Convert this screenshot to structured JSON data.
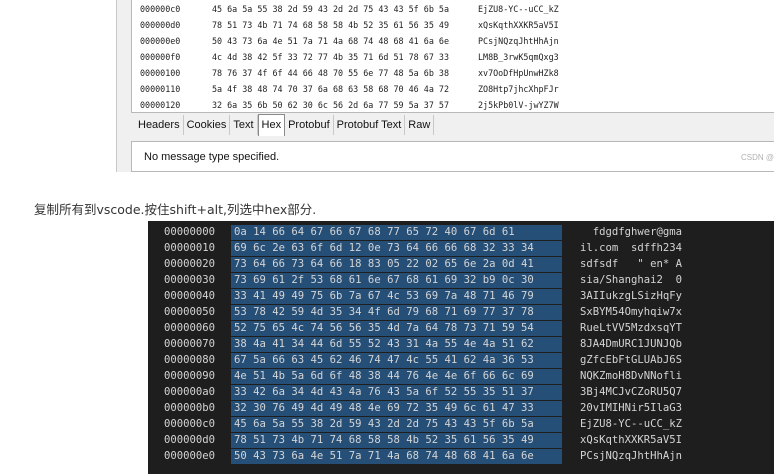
{
  "top_panel": {
    "rows": [
      {
        "offset": "000000c0",
        "hex": "45 6a 5a 55 38 2d 59 43 2d 2d 75 43 43 5f 6b 5a",
        "ascii": "EjZU8-YC--uCC_kZ"
      },
      {
        "offset": "000000d0",
        "hex": "78 51 73 4b 71 74 68 58 58 4b 52 35 61 56 35 49",
        "ascii": "xQsKqthXXKR5aV5I"
      },
      {
        "offset": "000000e0",
        "hex": "50 43 73 6a 4e 51 7a 71 4a 68 74 48 68 41 6a 6e",
        "ascii": "PCsjNQzqJhtHhAjn"
      },
      {
        "offset": "000000f0",
        "hex": "4c 4d 38 42 5f 33 72 77 4b 35 71 6d 51 78 67 33",
        "ascii": "LM8B_3rwK5qmQxg3"
      },
      {
        "offset": "00000100",
        "hex": "78 76 37 4f 6f 44 66 48 70 55 6e 77 48 5a 6b 38",
        "ascii": "xv7OoDfHpUnwHZk8"
      },
      {
        "offset": "00000110",
        "hex": "5a 4f 38 48 74 70 37 6a 68 63 58 68 70 46 4a 72",
        "ascii": "ZO8Htp7jhcXhpFJr"
      },
      {
        "offset": "00000120",
        "hex": "32 6a 35 6b 50 62 30 6c 56 2d 6a 77 59 5a 37 57",
        "ascii": "2j5kPb0lV-jwYZ7W"
      }
    ],
    "tabs": [
      {
        "label": "Headers",
        "active": false
      },
      {
        "label": "Cookies",
        "active": false
      },
      {
        "label": "Text",
        "active": false
      },
      {
        "label": "Hex",
        "active": true
      },
      {
        "label": "Protobuf",
        "active": false
      },
      {
        "label": "Protobuf Text",
        "active": false
      },
      {
        "label": "Raw",
        "active": false
      }
    ],
    "status": "No message type specified.",
    "watermark": "CSDN @"
  },
  "caption": "复制所有到vscode.按住shift+alt,列选中hex部分.",
  "vscode": {
    "selection_color": "#264f78",
    "background": "#1e1e1e",
    "rows": [
      {
        "offset": "00000000",
        "hex": "0a 14 66 64 67 66 67 68 77 65 72 40 67 6d 61",
        "ascii": "  fdgdfghwer@gma"
      },
      {
        "offset": "00000010",
        "hex": "69 6c 2e 63 6f 6d 12 0e 73 64 66 66 68 32 33 34",
        "ascii": "il.com  sdffh234"
      },
      {
        "offset": "00000020",
        "hex": "73 64 66 73 64 66 18 83 05 22 02 65 6e 2a 0d 41",
        "ascii": "sdfsdf   \" en* A"
      },
      {
        "offset": "00000030",
        "hex": "73 69 61 2f 53 68 61 6e 67 68 61 69 32 b9 0c 30",
        "ascii": "sia/Shanghai2  0"
      },
      {
        "offset": "00000040",
        "hex": "33 41 49 49 75 6b 7a 67 4c 53 69 7a 48 71 46 79",
        "ascii": "3AIIukzgLSizHqFy"
      },
      {
        "offset": "00000050",
        "hex": "53 78 42 59 4d 35 34 4f 6d 79 68 71 69 77 37 78",
        "ascii": "SxBYM54Omyhqiw7x"
      },
      {
        "offset": "00000060",
        "hex": "52 75 65 4c 74 56 56 35 4d 7a 64 78 73 71 59 54",
        "ascii": "RueLtVV5MzdxsqYT"
      },
      {
        "offset": "00000070",
        "hex": "38 4a 41 34 44 6d 55 52 43 31 4a 55 4e 4a 51 62",
        "ascii": "8JA4DmURC1JUNJQb"
      },
      {
        "offset": "00000080",
        "hex": "67 5a 66 63 45 62 46 74 47 4c 55 41 62 4a 36 53",
        "ascii": "gZfcEbFtGLUAbJ6S"
      },
      {
        "offset": "00000090",
        "hex": "4e 51 4b 5a 6d 6f 48 38 44 76 4e 4e 6f 66 6c 69",
        "ascii": "NQKZmoH8DvNNofli"
      },
      {
        "offset": "000000a0",
        "hex": "33 42 6a 34 4d 43 4a 76 43 5a 6f 52 55 35 51 37",
        "ascii": "3Bj4MCJvCZoRU5Q7"
      },
      {
        "offset": "000000b0",
        "hex": "32 30 76 49 4d 49 48 4e 69 72 35 49 6c 61 47 33",
        "ascii": "20vIMIHNir5IlaG3"
      },
      {
        "offset": "000000c0",
        "hex": "45 6a 5a 55 38 2d 59 43 2d 2d 75 43 43 5f 6b 5a",
        "ascii": "EjZU8-YC--uCC_kZ"
      },
      {
        "offset": "000000d0",
        "hex": "78 51 73 4b 71 74 68 58 58 4b 52 35 61 56 35 49",
        "ascii": "xQsKqthXXKR5aV5I"
      },
      {
        "offset": "000000e0",
        "hex": "50 43 73 6a 4e 51 7a 71 4a 68 74 48 68 41 6a 6e",
        "ascii": "PCsjNQzqJhtHhAjn"
      }
    ]
  }
}
